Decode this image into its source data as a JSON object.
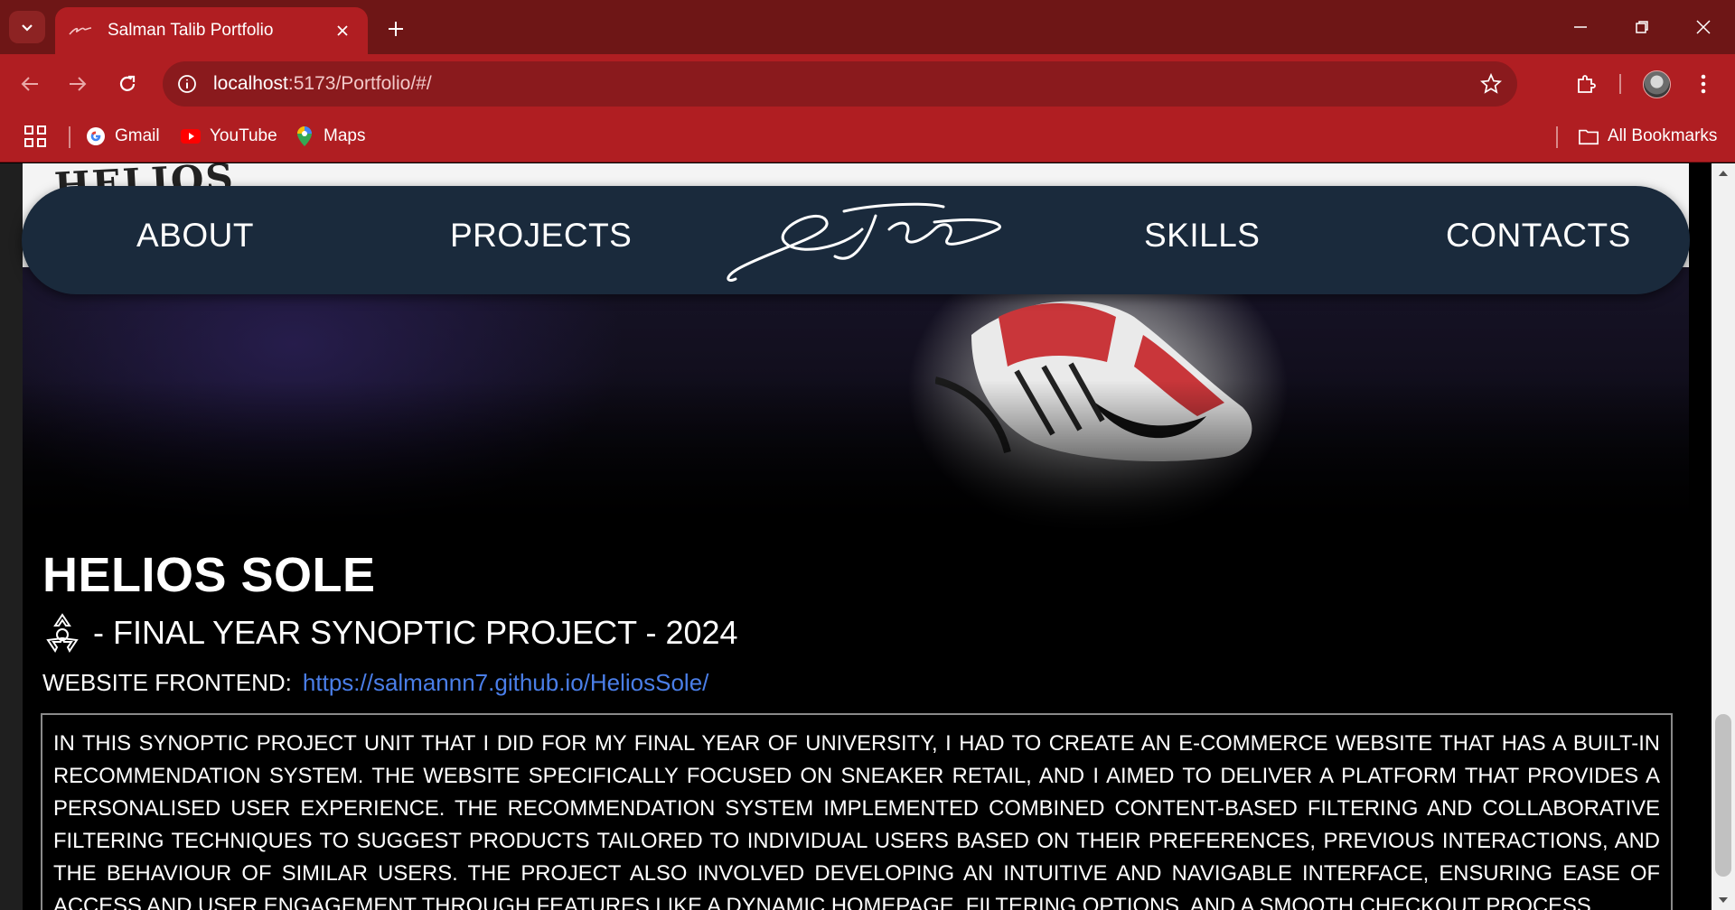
{
  "browser": {
    "tab_title": "Salman Talib Portfolio",
    "url_host": "localhost",
    "url_rest": ":5173/Portfolio/#/",
    "bookmarks": [
      {
        "label": "Gmail",
        "icon": "gmail-icon"
      },
      {
        "label": "YouTube",
        "icon": "youtube-icon"
      },
      {
        "label": "Maps",
        "icon": "maps-icon"
      }
    ],
    "all_bookmarks_label": "All Bookmarks",
    "colors": {
      "frame": "#6e1616",
      "toolbar": "#b01e22",
      "omnibox": "#8a1a1d"
    }
  },
  "site": {
    "nav": {
      "about": "ABOUT",
      "projects": "PROJECTS",
      "skills": "SKILLS",
      "contacts": "CONTACTS",
      "nav_bg": "#1a2a3c"
    },
    "project": {
      "title": "HELIOS SOLE",
      "subtitle": "- FINAL YEAR SYNOPTIC PROJECT - 2024",
      "link_label": "WEBSITE FRONTEND:",
      "link_url": "https://salmannn7.github.io/HeliosSole/",
      "description": "In this synoptic project unit that I did for my final year of university, I had to create an e-commerce website that has a built-in recommendation system. The website specifically focused on sneaker retail, and I aimed to deliver a platform that provides a personalised user experience. The recommendation system implemented combined content-based filtering and collaborative filtering techniques to suggest products tailored to individual users based on their preferences, previous interactions, and the behaviour of similar users. The project also involved developing an intuitive and navigable interface, ensuring ease of access and user engagement through features like a dynamic homepage, filtering options, and a smooth checkout process."
    }
  }
}
